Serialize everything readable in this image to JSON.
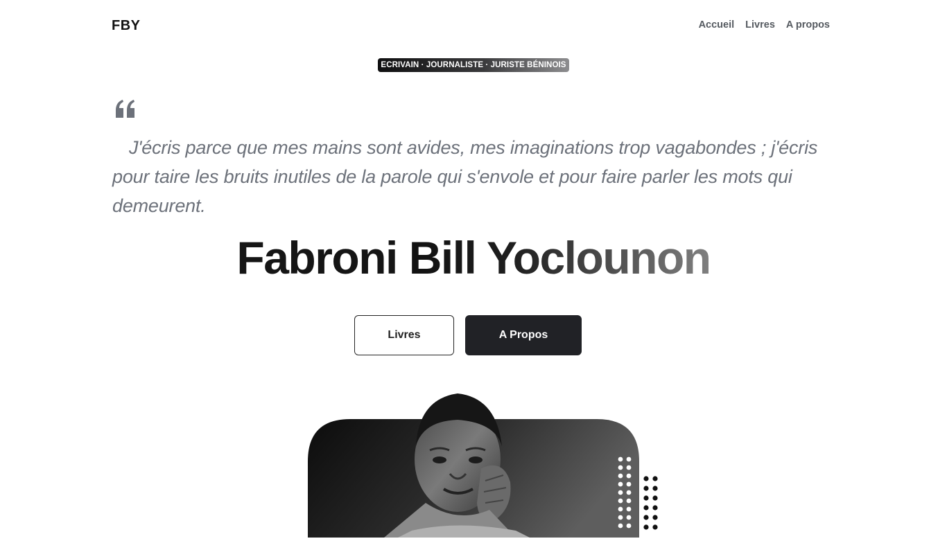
{
  "nav": {
    "logo": "FBY",
    "links": [
      "Accueil",
      "Livres",
      "A propos"
    ]
  },
  "hero": {
    "badge": "ECRIVAIN · JOURNALISTE · JURISTE BÉNINOIS",
    "quote": "J'écris parce que mes mains sont avides, mes imaginations trop vagabondes ; j'écris pour taire les bruits inutiles de la parole qui s'envole et pour faire parler les mots qui demeurent.",
    "name_first": "Fabroni",
    "name_rest": "Bill Yoclounon",
    "buttons": {
      "books": "Livres",
      "about": "A Propos"
    }
  },
  "icons": {
    "quote": "quote-icon",
    "dots": "dots-decoration"
  },
  "colors": {
    "primary_dark": "#212226",
    "muted_text": "#6c717a",
    "nav_text": "#555a60"
  }
}
